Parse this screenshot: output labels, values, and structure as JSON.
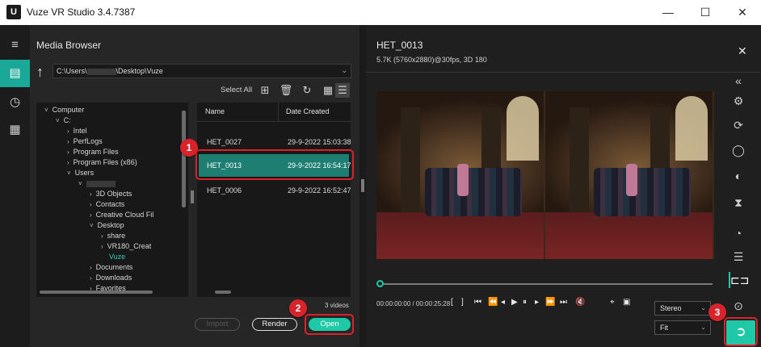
{
  "window": {
    "logo_letter": "U",
    "title": "Vuze VR Studio 3.4.7387",
    "minimize": "—",
    "maximize": "☐",
    "close": "✕"
  },
  "rail": {
    "menu_icon": "hamburger-icon",
    "items": [
      {
        "icon": "media-browser-icon",
        "active": true
      },
      {
        "icon": "timer-icon",
        "active": false
      },
      {
        "icon": "clapperboard-icon",
        "active": false
      }
    ]
  },
  "media_browser": {
    "title": "Media Browser",
    "path_prefix": "C:\\Users\\",
    "path_suffix": "\\Desktop\\Vuze",
    "select_all": "Select All",
    "tree": [
      {
        "label": "Computer",
        "indent": 0,
        "caret": "˅"
      },
      {
        "label": "C:",
        "indent": 1,
        "caret": "˅"
      },
      {
        "label": "Intel",
        "indent": 2,
        "caret": "›"
      },
      {
        "label": "PerfLogs",
        "indent": 2,
        "caret": "›"
      },
      {
        "label": "Program Files",
        "indent": 2,
        "caret": "›"
      },
      {
        "label": "Program Files (x86)",
        "indent": 2,
        "caret": "›"
      },
      {
        "label": "Users",
        "indent": 2,
        "caret": "˅"
      },
      {
        "label": "",
        "indent": 3,
        "caret": "˅",
        "blurred": true
      },
      {
        "label": "3D Objects",
        "indent": 4,
        "caret": "›"
      },
      {
        "label": "Contacts",
        "indent": 4,
        "caret": "›"
      },
      {
        "label": "Creative Cloud Fil",
        "indent": 4,
        "caret": "›"
      },
      {
        "label": "Desktop",
        "indent": 4,
        "caret": "˅"
      },
      {
        "label": "share",
        "indent": 5,
        "caret": "›"
      },
      {
        "label": "VR180_Creat",
        "indent": 5,
        "caret": "›"
      },
      {
        "label": "Vuze",
        "indent": 5,
        "caret": "",
        "selected": true
      },
      {
        "label": "Documents",
        "indent": 4,
        "caret": "›"
      },
      {
        "label": "Downloads",
        "indent": 4,
        "caret": "›"
      },
      {
        "label": "Favorites",
        "indent": 4,
        "caret": "›"
      }
    ],
    "columns": {
      "name": "Name",
      "date": "Date Created"
    },
    "files": [
      {
        "name": "HET_0027",
        "date": "29-9-2022 15:03:38",
        "selected": false
      },
      {
        "name": "HET_0013",
        "date": "29-9-2022 16:54:17",
        "selected": true
      },
      {
        "name": "HET_0006",
        "date": "29-9-2022 16:52:47",
        "selected": false
      }
    ],
    "count": "3 videos",
    "buttons": {
      "import": "Import",
      "render": "Render",
      "open": "Open"
    }
  },
  "preview": {
    "title": "HET_0013",
    "subtitle": "5.7K (5760x2880)@30fps, 3D 180",
    "close": "✕",
    "timecode": "00:00:00:00 / 00:00:25:28",
    "view_mode": "Stereo",
    "fit_mode": "Fit"
  },
  "tools": {
    "collapse": "«",
    "items": [
      "settings-icon",
      "rotate-icon",
      "sphere-icon",
      "stabilize-icon",
      "trim-icon",
      "speed-icon",
      "adjustments-icon",
      "view-icon",
      "snapshot-icon"
    ],
    "export": "export-icon"
  },
  "callouts": [
    "1",
    "2",
    "3"
  ],
  "colors": {
    "accent": "#1fc9a8",
    "selected_row": "#1e7e72",
    "callout": "#d8232a"
  }
}
